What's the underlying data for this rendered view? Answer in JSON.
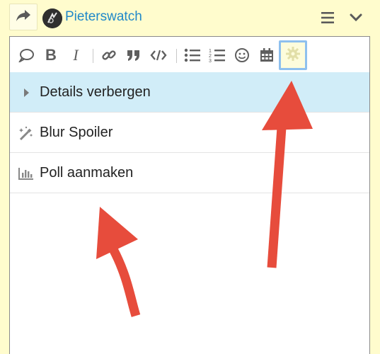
{
  "header": {
    "username": "Pieterswatch"
  },
  "toolbar": {
    "buttons": [
      {
        "name": "quote-icon"
      },
      {
        "name": "bold-icon",
        "glyph": "B"
      },
      {
        "name": "italic-icon",
        "glyph": "I"
      },
      {
        "name": "link-icon"
      },
      {
        "name": "blockquote-icon"
      },
      {
        "name": "code-icon"
      },
      {
        "name": "bullet-list-icon"
      },
      {
        "name": "numbered-list-icon"
      },
      {
        "name": "emoji-icon"
      },
      {
        "name": "calendar-icon"
      },
      {
        "name": "gear-icon"
      }
    ]
  },
  "menu": {
    "items": [
      {
        "label": "Details verbergen",
        "icon": "caret-right-icon",
        "active": true
      },
      {
        "label": "Blur Spoiler",
        "icon": "magic-wand-icon",
        "active": false
      },
      {
        "label": "Poll aanmaken",
        "icon": "bar-chart-icon",
        "active": false
      }
    ]
  },
  "colors": {
    "page_background": "#fffccd",
    "username": "#1f88c9",
    "active_row": "#d1edf8",
    "gear_highlight": "#8ec0ee",
    "annotation_arrow": "#e74c3c"
  }
}
